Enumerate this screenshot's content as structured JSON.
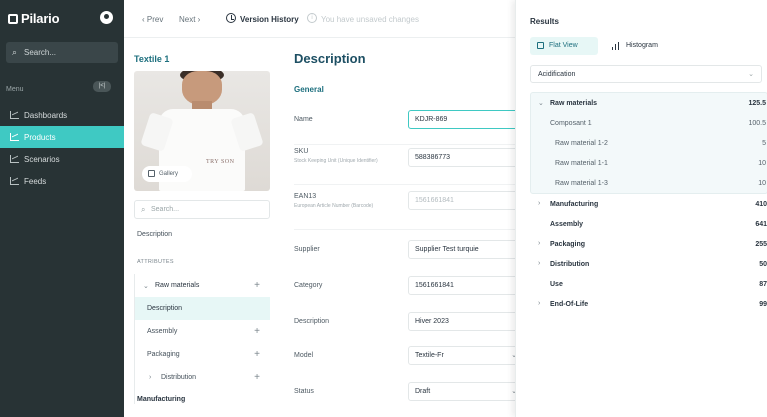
{
  "sidebar": {
    "logo": "Pilario",
    "search_placeholder": "Search...",
    "menu_label": "Menu",
    "menu_toggle": "|<|",
    "items": [
      {
        "label": "Dashboards",
        "active": false
      },
      {
        "label": "Products",
        "active": true
      },
      {
        "label": "Scenarios",
        "active": false
      },
      {
        "label": "Feeds",
        "active": false
      }
    ]
  },
  "topbar": {
    "prev": "‹ Prev",
    "next": "Next ›",
    "version_history": "Version History",
    "unsaved": "You have unsaved changes"
  },
  "product": {
    "title": "Textile 1",
    "image_print": "TRY SON",
    "gallery": "Gallery",
    "search_placeholder": "Search...",
    "description_link": "Description",
    "attributes_heading": "ATTRIBUTES",
    "tree": [
      {
        "label": "Raw materials",
        "prefix": "⌄",
        "plus": "+"
      },
      {
        "label": "Description",
        "prefix": "",
        "plus": ""
      },
      {
        "label": "Assembly",
        "prefix": "",
        "plus": "+"
      },
      {
        "label": "Packaging",
        "prefix": "",
        "plus": "+"
      },
      {
        "label": "Distribution",
        "prefix": "›",
        "plus": "+"
      }
    ],
    "manufacturing": "Manufacturing"
  },
  "description": {
    "title": "Description",
    "section": "General",
    "fields": [
      {
        "label": "Name",
        "sub": "",
        "value": "KDJR-869"
      },
      {
        "label": "SKU",
        "sub": "Stock Keeping Unit (Unique Identifier)",
        "value": "588386773"
      },
      {
        "label": "EAN13",
        "sub": "European Article Number (Barcode)",
        "value": "1561661841"
      },
      {
        "label": "Supplier",
        "sub": "",
        "value": "Supplier Test turquie"
      },
      {
        "label": "Category",
        "sub": "",
        "value": "1561661841"
      },
      {
        "label": "Description",
        "sub": "",
        "value": "Hiver 2023"
      },
      {
        "label": "Model",
        "sub": "",
        "value": "Textile-Fr"
      },
      {
        "label": "Status",
        "sub": "",
        "value": "Draft"
      }
    ]
  },
  "results": {
    "title": "Results",
    "tab_flat": "Flat View",
    "tab_histogram": "Histogram",
    "indicator": "Acidification",
    "rows": [
      {
        "label": "Raw materials",
        "value": "125.5",
        "chev": "⌄"
      },
      {
        "label": "Composant 1",
        "value": "100.5",
        "chev": ""
      },
      {
        "label": "Raw material 1-2",
        "value": "5",
        "chev": ""
      },
      {
        "label": "Raw material 1-1",
        "value": "10",
        "chev": ""
      },
      {
        "label": "Raw material 1-3",
        "value": "10",
        "chev": ""
      },
      {
        "label": "Manufacturing",
        "value": "410",
        "chev": "›"
      },
      {
        "label": "Assembly",
        "value": "641",
        "chev": ""
      },
      {
        "label": "Packaging",
        "value": "255",
        "chev": "›"
      },
      {
        "label": "Distribution",
        "value": "50",
        "chev": "›"
      },
      {
        "label": "Use",
        "value": "87",
        "chev": ""
      },
      {
        "label": "End-Of-Life",
        "value": "99",
        "chev": "›"
      }
    ]
  }
}
